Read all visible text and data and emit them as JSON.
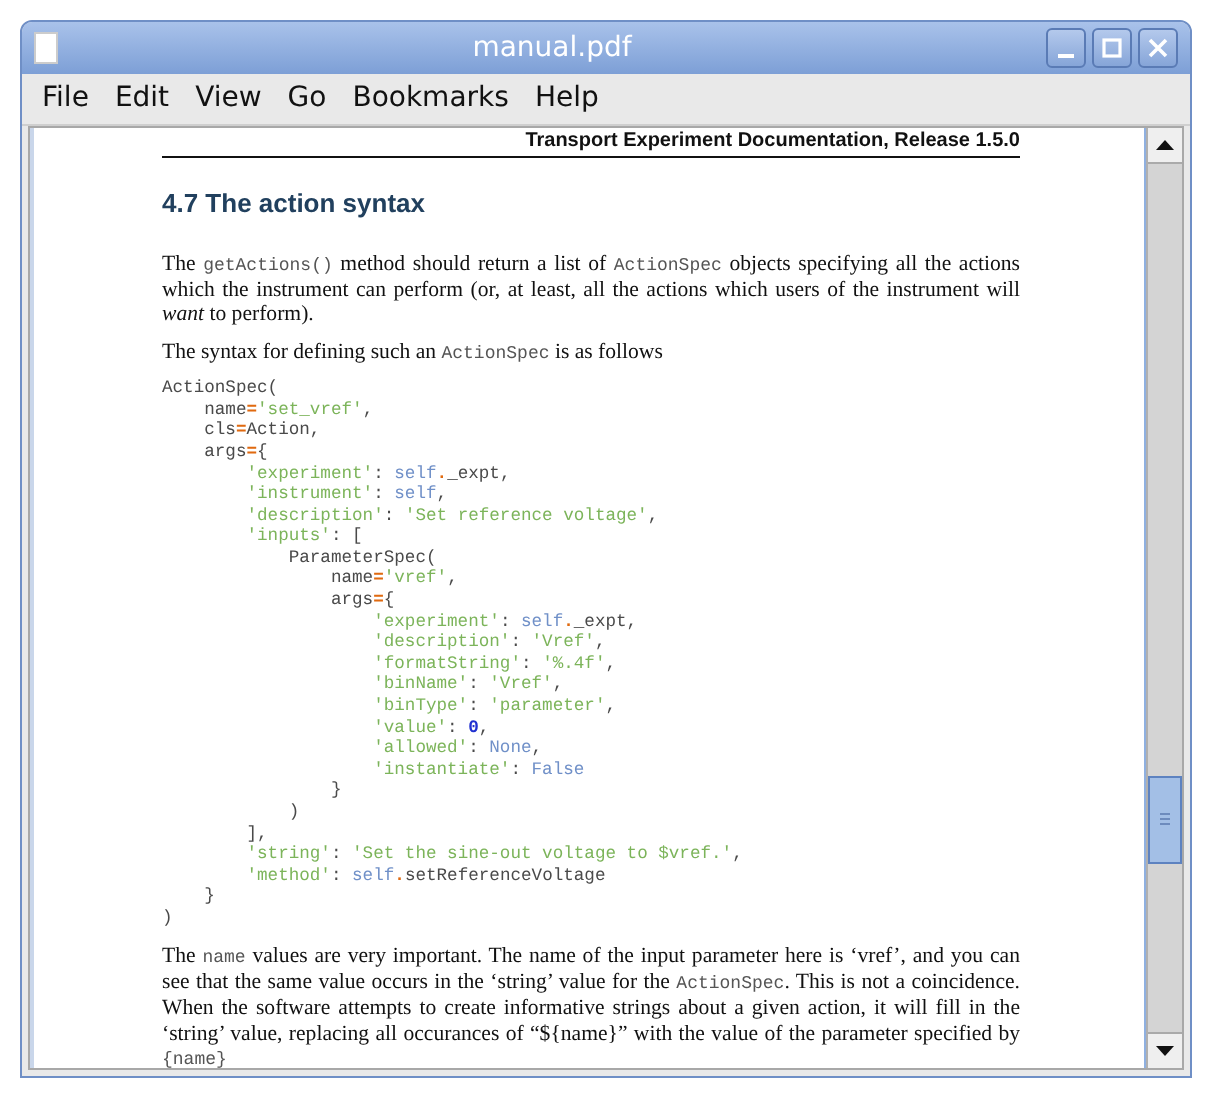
{
  "window": {
    "title": "manual.pdf"
  },
  "menu": [
    "File",
    "Edit",
    "View",
    "Go",
    "Bookmarks",
    "Help"
  ],
  "page": {
    "running_header": "Transport Experiment Documentation, Release 1.5.0",
    "heading": "4.7  The action syntax",
    "paragraphs_before": [
      [
        {
          "kind": "text",
          "text": "The "
        },
        {
          "kind": "code",
          "text": "getActions()"
        },
        {
          "kind": "text",
          "text": " method should return a list of "
        },
        {
          "kind": "code",
          "text": "ActionSpec"
        },
        {
          "kind": "text",
          "text": " objects specifying all the actions which the instrument can perform (or, at least, all the actions which users of the instrument will "
        },
        {
          "kind": "em",
          "text": "want"
        },
        {
          "kind": "text",
          "text": " to perform)."
        }
      ],
      [
        {
          "kind": "text",
          "text": "The syntax for defining such an "
        },
        {
          "kind": "code",
          "text": "ActionSpec"
        },
        {
          "kind": "text",
          "text": " is as follows"
        }
      ]
    ],
    "code_lines": [
      [
        {
          "kind": "plain",
          "text": "ActionSpec("
        }
      ],
      [
        {
          "kind": "plain",
          "text": "    name"
        },
        {
          "kind": "op",
          "text": "="
        },
        {
          "kind": "string",
          "text": "'set_vref'"
        },
        {
          "kind": "plain",
          "text": ","
        }
      ],
      [
        {
          "kind": "plain",
          "text": "    cls"
        },
        {
          "kind": "op",
          "text": "="
        },
        {
          "kind": "plain",
          "text": "Action,"
        }
      ],
      [
        {
          "kind": "plain",
          "text": "    args"
        },
        {
          "kind": "op",
          "text": "="
        },
        {
          "kind": "plain",
          "text": "{"
        }
      ],
      [
        {
          "kind": "string",
          "text": "        'experiment'"
        },
        {
          "kind": "plain",
          "text": ": "
        },
        {
          "kind": "builtin",
          "text": "self"
        },
        {
          "kind": "op",
          "text": "."
        },
        {
          "kind": "plain",
          "text": "_expt,"
        }
      ],
      [
        {
          "kind": "string",
          "text": "        'instrument'"
        },
        {
          "kind": "plain",
          "text": ": "
        },
        {
          "kind": "builtin",
          "text": "self"
        },
        {
          "kind": "plain",
          "text": ","
        }
      ],
      [
        {
          "kind": "string",
          "text": "        'description'"
        },
        {
          "kind": "plain",
          "text": ": "
        },
        {
          "kind": "string",
          "text": "'Set reference voltage'"
        },
        {
          "kind": "plain",
          "text": ","
        }
      ],
      [
        {
          "kind": "string",
          "text": "        'inputs'"
        },
        {
          "kind": "plain",
          "text": ": ["
        }
      ],
      [
        {
          "kind": "plain",
          "text": "            ParameterSpec("
        }
      ],
      [
        {
          "kind": "plain",
          "text": "                name"
        },
        {
          "kind": "op",
          "text": "="
        },
        {
          "kind": "string",
          "text": "'vref'"
        },
        {
          "kind": "plain",
          "text": ","
        }
      ],
      [
        {
          "kind": "plain",
          "text": "                args"
        },
        {
          "kind": "op",
          "text": "="
        },
        {
          "kind": "plain",
          "text": "{"
        }
      ],
      [
        {
          "kind": "string",
          "text": "                    'experiment'"
        },
        {
          "kind": "plain",
          "text": ": "
        },
        {
          "kind": "builtin",
          "text": "self"
        },
        {
          "kind": "op",
          "text": "."
        },
        {
          "kind": "plain",
          "text": "_expt,"
        }
      ],
      [
        {
          "kind": "string",
          "text": "                    'description'"
        },
        {
          "kind": "plain",
          "text": ": "
        },
        {
          "kind": "string",
          "text": "'Vref'"
        },
        {
          "kind": "plain",
          "text": ","
        }
      ],
      [
        {
          "kind": "string",
          "text": "                    'formatString'"
        },
        {
          "kind": "plain",
          "text": ": "
        },
        {
          "kind": "string",
          "text": "'%.4f'"
        },
        {
          "kind": "plain",
          "text": ","
        }
      ],
      [
        {
          "kind": "string",
          "text": "                    'binName'"
        },
        {
          "kind": "plain",
          "text": ": "
        },
        {
          "kind": "string",
          "text": "'Vref'"
        },
        {
          "kind": "plain",
          "text": ","
        }
      ],
      [
        {
          "kind": "string",
          "text": "                    'binType'"
        },
        {
          "kind": "plain",
          "text": ": "
        },
        {
          "kind": "string",
          "text": "'parameter'"
        },
        {
          "kind": "plain",
          "text": ","
        }
      ],
      [
        {
          "kind": "string",
          "text": "                    'value'"
        },
        {
          "kind": "plain",
          "text": ": "
        },
        {
          "kind": "number",
          "text": "0"
        },
        {
          "kind": "plain",
          "text": ","
        }
      ],
      [
        {
          "kind": "string",
          "text": "                    'allowed'"
        },
        {
          "kind": "plain",
          "text": ": "
        },
        {
          "kind": "builtin",
          "text": "None"
        },
        {
          "kind": "plain",
          "text": ","
        }
      ],
      [
        {
          "kind": "string",
          "text": "                    'instantiate'"
        },
        {
          "kind": "plain",
          "text": ": "
        },
        {
          "kind": "builtin",
          "text": "False"
        }
      ],
      [
        {
          "kind": "plain",
          "text": "                }"
        }
      ],
      [
        {
          "kind": "plain",
          "text": "            )"
        }
      ],
      [
        {
          "kind": "plain",
          "text": "        ],"
        }
      ],
      [
        {
          "kind": "string",
          "text": "        'string'"
        },
        {
          "kind": "plain",
          "text": ": "
        },
        {
          "kind": "string",
          "text": "'Set the sine-out voltage to $vref.'"
        },
        {
          "kind": "plain",
          "text": ","
        }
      ],
      [
        {
          "kind": "string",
          "text": "        'method'"
        },
        {
          "kind": "plain",
          "text": ": "
        },
        {
          "kind": "builtin",
          "text": "self"
        },
        {
          "kind": "op",
          "text": "."
        },
        {
          "kind": "plain",
          "text": "setReferenceVoltage"
        }
      ],
      [
        {
          "kind": "plain",
          "text": "    }"
        }
      ],
      [
        {
          "kind": "plain",
          "text": ")"
        }
      ]
    ],
    "paragraphs_after": [
      [
        {
          "kind": "text",
          "text": "The "
        },
        {
          "kind": "code",
          "text": "name"
        },
        {
          "kind": "text",
          "text": " values are very important. The name of the input parameter here is ‘vref’, and you can see that the same value occurs in the ‘string’ value for the "
        },
        {
          "kind": "code",
          "text": "ActionSpec"
        },
        {
          "kind": "text",
          "text": ". This is not a coincidence. When the software attempts to create informative strings about a given action, it will fill in the ‘string’ value, replacing all occurances of “${name}” with the value of the parameter specified by "
        },
        {
          "kind": "code",
          "text": "{name}"
        }
      ]
    ]
  }
}
